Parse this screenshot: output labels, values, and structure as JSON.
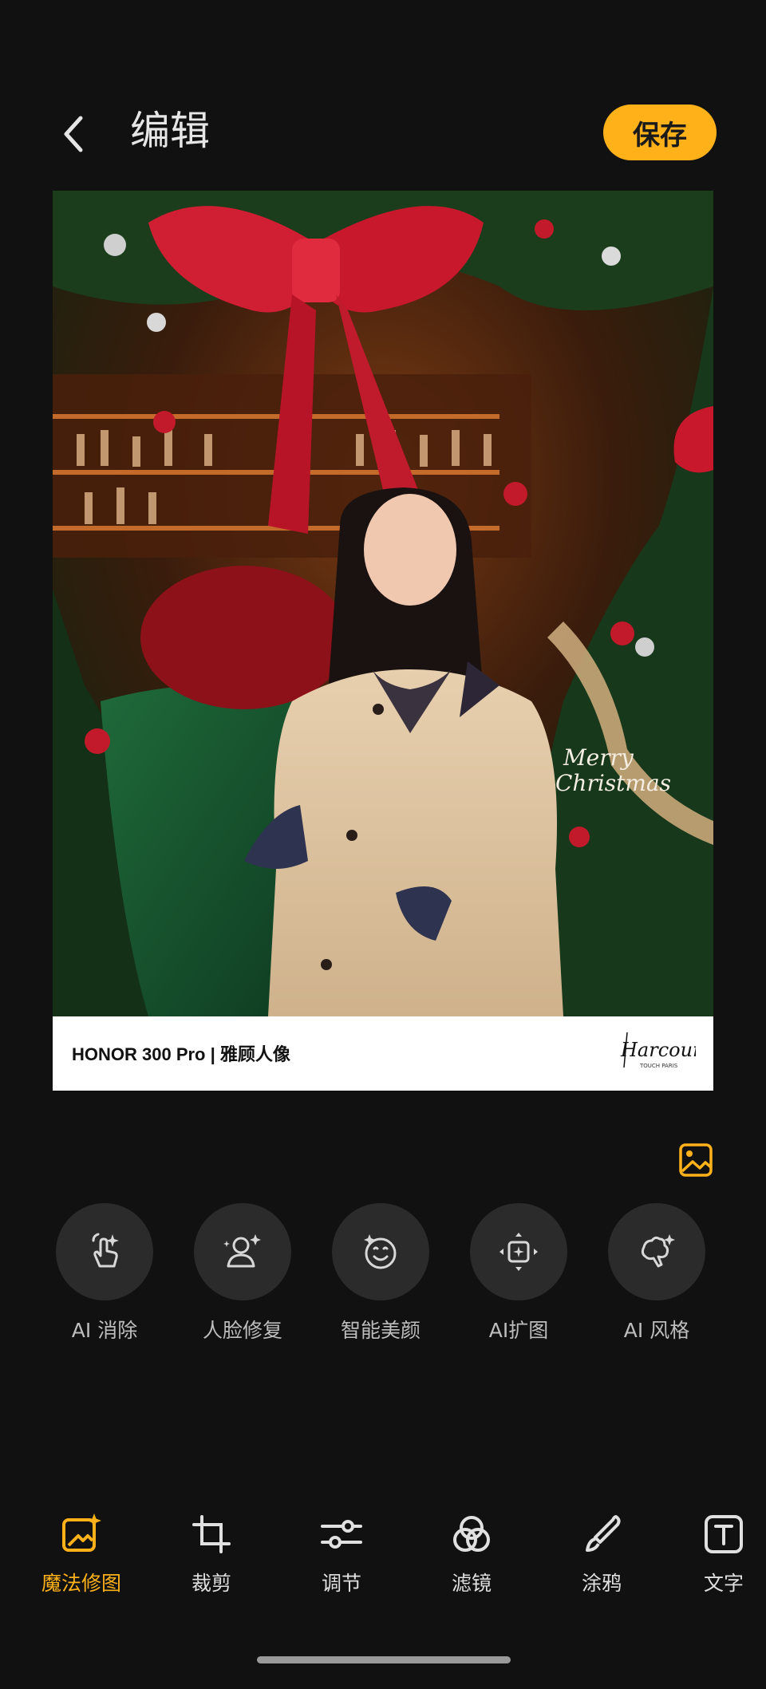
{
  "header": {
    "title": "编辑",
    "save_label": "保存"
  },
  "photo": {
    "watermark_text": "HONOR 300 Pro | 雅顾人像",
    "logo_text": "Harcourt",
    "logo_sub": "TOUCH PARIS"
  },
  "ai_tools": [
    {
      "label": "AI 消除",
      "icon": "tap-sparkle-icon"
    },
    {
      "label": "人脸修复",
      "icon": "face-restore-icon"
    },
    {
      "label": "智能美颜",
      "icon": "beauty-face-icon"
    },
    {
      "label": "AI扩图",
      "icon": "expand-image-icon"
    },
    {
      "label": "AI 风格",
      "icon": "ai-style-icon"
    }
  ],
  "bottom_tabs": [
    {
      "label": "魔法修图",
      "icon": "magic-edit-icon",
      "active": true
    },
    {
      "label": "裁剪",
      "icon": "crop-icon",
      "active": false
    },
    {
      "label": "调节",
      "icon": "adjust-sliders-icon",
      "active": false
    },
    {
      "label": "滤镜",
      "icon": "filter-icon",
      "active": false
    },
    {
      "label": "涂鸦",
      "icon": "brush-icon",
      "active": false
    },
    {
      "label": "文字",
      "icon": "text-icon",
      "active": false
    }
  ],
  "colors": {
    "accent": "#ffb11a",
    "background": "#111111",
    "tool_circle": "#2b2b2b"
  }
}
